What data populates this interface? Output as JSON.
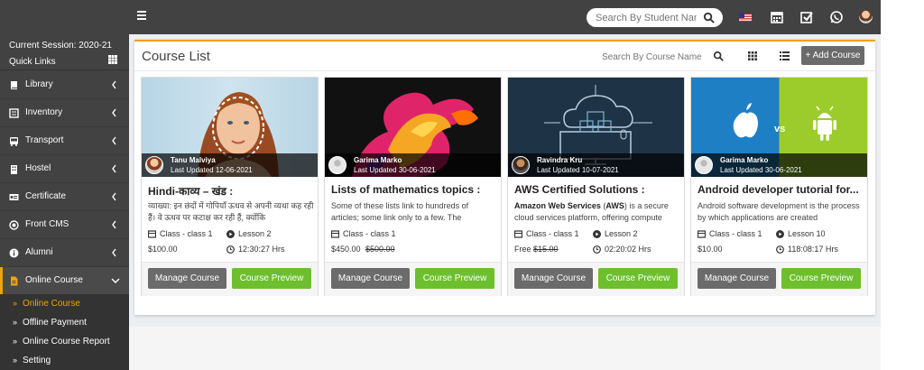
{
  "topbar": {
    "search_placeholder": "Search By Student Name",
    "icons": [
      "hamburger-icon",
      "search-icon",
      "us-flag-icon",
      "calendar-icon",
      "checkbox-icon",
      "whatsapp-icon",
      "user-avatar"
    ]
  },
  "sidebar": {
    "session": "Current Session: 2020-21",
    "quick_links": "Quick Links",
    "items": [
      {
        "label": "Library",
        "icon": "book-icon"
      },
      {
        "label": "Inventory",
        "icon": "inventory-icon"
      },
      {
        "label": "Transport",
        "icon": "bus-icon"
      },
      {
        "label": "Hostel",
        "icon": "building-icon"
      },
      {
        "label": "Certificate",
        "icon": "certificate-icon"
      },
      {
        "label": "Front CMS",
        "icon": "globe-icon"
      },
      {
        "label": "Alumni",
        "icon": "info-icon"
      },
      {
        "label": "Online Course",
        "icon": "file-icon"
      }
    ],
    "sub_items": [
      {
        "label": "Online Course"
      },
      {
        "label": "Offline Payment"
      },
      {
        "label": "Online Course Report"
      },
      {
        "label": "Setting"
      }
    ]
  },
  "panel": {
    "title": "Course List",
    "search_placeholder": "Search By Course Name",
    "add_label": "Add Course",
    "add_prefix": "+"
  },
  "courses": [
    {
      "author": "Tanu Malviya",
      "updated": "Last Updated 12-06-2021",
      "title": "Hindi-काव्य – खंड :",
      "desc": "व्याख्या: इन छंदों में गोपियाँ ऊधव से अपनी व्यथा कह रही हैं। वे ऊधव पर कटाक्ष कर रही हैं, क्योंकि",
      "class": "Class - class 1",
      "lessons": "Lesson 2",
      "price": "$100.00",
      "old_price": "",
      "duration": "12:30:27 Hrs"
    },
    {
      "author": "Garima Marko",
      "updated": "Last Updated 30-06-2021",
      "title": "Lists of mathematics topics :",
      "desc": "Some of these lists link to hundreds of articles; some link only to a few. The",
      "class": "Class - class 1",
      "lessons": "",
      "price": "$450.00",
      "old_price": "$500.00",
      "duration": ""
    },
    {
      "author": "Ravindra Kru",
      "updated": "Last Updated 10-07-2021",
      "title": "AWS Certified Solutions :",
      "desc_bold": "Amazon Web Services",
      "desc_bold2": "AWS",
      "desc_rest": ") is a secure cloud services platform, offering compute",
      "class": "Class - class 1",
      "lessons": "Lesson 2",
      "price": "Free",
      "old_price": "$15.00",
      "duration": "02:20:02 Hrs"
    },
    {
      "author": "Garima Marko",
      "updated": "Last Updated 30-06-2021",
      "title": "Android developer tutorial for...",
      "desc": "Android software development is the process by which applications are created",
      "class": "Class - class 1",
      "lessons": "Lesson 10",
      "price": "$10.00",
      "old_price": "",
      "duration": "118:08:17 Hrs"
    }
  ],
  "card_buttons": {
    "manage": "Manage Course",
    "preview": "Course Preview"
  },
  "android_thumb": {
    "vs": "vs"
  },
  "colors": {
    "topbar": "#424242",
    "sidebar": "#424242",
    "accent": "#f0a20b",
    "preview_button": "#6dbf2e",
    "manage_button": "#6b6b6b"
  }
}
